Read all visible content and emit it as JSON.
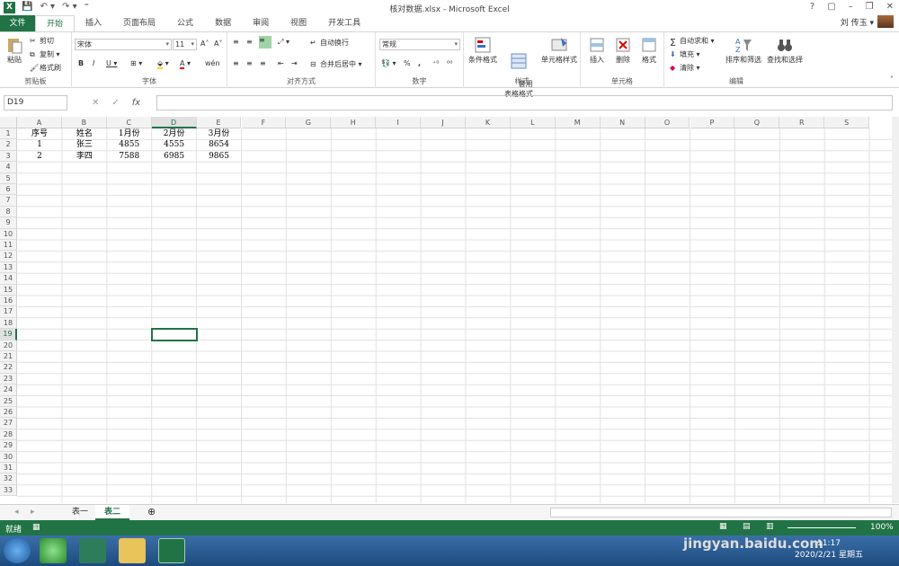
{
  "window": {
    "title": "核对数据.xlsx - Microsoft Excel",
    "app_icon": "X",
    "controls": [
      "?",
      "▢",
      "–",
      "❐",
      "✕"
    ]
  },
  "ribbon_tabs": {
    "file": "文件",
    "items": [
      "开始",
      "插入",
      "页面布局",
      "公式",
      "数据",
      "审阅",
      "视图",
      "开发工具"
    ],
    "active": "开始"
  },
  "user": {
    "name": "刘 传玉 ▾"
  },
  "ribbon": {
    "clipboard": {
      "label": "剪贴板",
      "paste": "粘贴",
      "cut": "剪切",
      "copy": "复制 ▾",
      "format_painter": "格式刷"
    },
    "font": {
      "label": "字体",
      "name": "宋体",
      "size": "11",
      "bold": "B",
      "italic": "I",
      "underline": "U ▾",
      "grow": "A˄",
      "shrink": "A˅",
      "wen": "wén"
    },
    "alignment": {
      "label": "对齐方式",
      "wrap": "自动换行",
      "merge": "合并后居中 ▾"
    },
    "number": {
      "label": "数字",
      "format": "常规",
      "percent": "%",
      "comma": ","
    },
    "styles": {
      "label": "样式",
      "conditional": "条件格式",
      "table": "套用\n表格格式",
      "cell_styles": "单元格样式"
    },
    "cells": {
      "label": "单元格",
      "insert": "插入",
      "delete": "删除",
      "format": "格式"
    },
    "editing": {
      "label": "编辑",
      "autosum": "自动求和",
      "fill": "填充 ▾",
      "clear": "清除 ▾",
      "sort": "排序和筛选",
      "find": "查找和选择"
    }
  },
  "formula_bar": {
    "name_box": "D19",
    "fx": "fx",
    "value": ""
  },
  "columns": [
    "A",
    "B",
    "C",
    "D",
    "E",
    "F",
    "G",
    "H",
    "I",
    "J",
    "K",
    "L",
    "M",
    "N",
    "O",
    "P",
    "Q",
    "R",
    "S"
  ],
  "selected_column": "D",
  "selected_row": 19,
  "row_numbers": [
    "1",
    "2",
    "3",
    "4",
    "5",
    "6",
    "7",
    "8",
    "9",
    "10",
    "11",
    "12",
    "13",
    "14",
    "15",
    "16",
    "17",
    "18",
    "19",
    "20",
    "21",
    "22",
    "23",
    "24",
    "25",
    "26",
    "27",
    "28",
    "29",
    "30",
    "31",
    "32",
    "33"
  ],
  "table": {
    "headers": [
      "序号",
      "姓名",
      "1月份",
      "2月份",
      "3月份"
    ],
    "rows": [
      [
        "1",
        "张三",
        "4855",
        "4555",
        "8654"
      ],
      [
        "2",
        "李四",
        "7588",
        "6985",
        "9865"
      ]
    ]
  },
  "sheets": {
    "tabs": [
      "表一",
      "表二"
    ],
    "active": "表二",
    "add": "⊕"
  },
  "status": {
    "ready": "就绪",
    "zoom": "100%"
  },
  "taskbar": {
    "time": "11:17",
    "date": "2020/2/21 星期五"
  },
  "watermark": "jingyan.baidu.com",
  "colors": {
    "accent": "#217346"
  }
}
